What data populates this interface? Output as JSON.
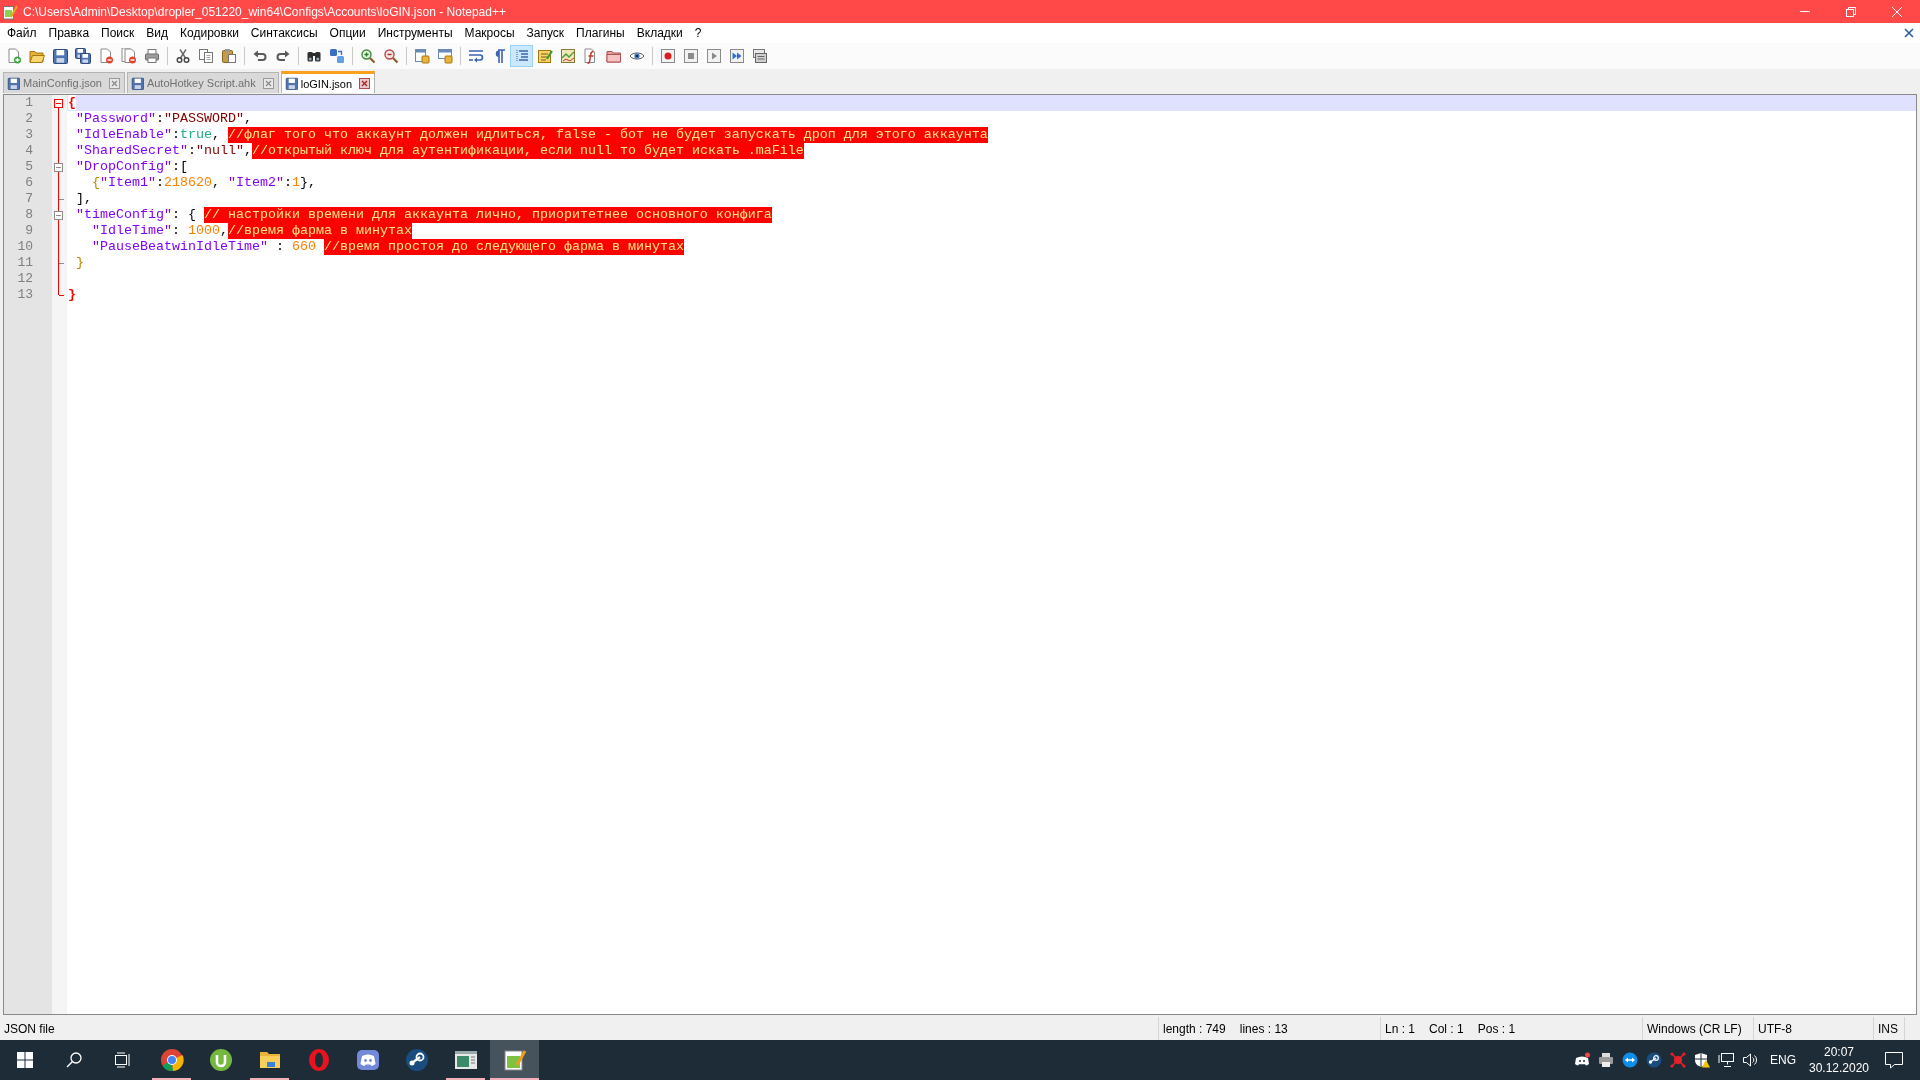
{
  "window": {
    "title": "C:\\Users\\Admin\\Desktop\\dropler_051220_win64\\Configs\\Accounts\\loGIN.json - Notepad++"
  },
  "menu": [
    "Файл",
    "Правка",
    "Поиск",
    "Вид",
    "Кодировки",
    "Синтаксисы",
    "Опции",
    "Инструменты",
    "Макросы",
    "Запуск",
    "Плагины",
    "Вкладки",
    "?"
  ],
  "toolbar": {
    "groups": [
      [
        {
          "on": false
        },
        {
          "on": false
        },
        {
          "on": false
        },
        {
          "on": false
        },
        {
          "on": false
        },
        {
          "on": false
        },
        {
          "on": false
        }
      ],
      [
        {
          "on": false
        },
        {
          "on": false
        },
        {
          "on": false
        }
      ],
      [
        {
          "on": false
        },
        {
          "on": false
        }
      ],
      [
        {
          "on": false
        },
        {
          "on": false
        }
      ],
      [
        {
          "on": false
        },
        {
          "on": false
        }
      ],
      [
        {
          "on": false
        },
        {
          "on": false
        }
      ],
      [
        {
          "on": false
        },
        {
          "on": false
        },
        {
          "on": true
        },
        {
          "on": false
        },
        {
          "on": false
        },
        {
          "on": false
        },
        {
          "on": false
        },
        {
          "on": false
        }
      ],
      [
        {
          "on": false
        },
        {
          "on": false
        },
        {
          "on": false
        },
        {
          "on": false
        },
        {
          "on": false
        }
      ]
    ]
  },
  "tabs": [
    {
      "label": "MainConfig.json",
      "selected": false
    },
    {
      "label": "AutoHotkey Script.ahk",
      "selected": false
    },
    {
      "label": "loGIN.json",
      "selected": true
    }
  ],
  "editor": {
    "lines": [
      {
        "number": "1",
        "current": true,
        "fold": {
          "kind": "start",
          "active": true
        },
        "tokens": [
          {
            "kind": "brace",
            "text": "{"
          }
        ]
      },
      {
        "number": "2",
        "current": false,
        "tokens": [
          {
            "kind": "key",
            "text": " \"Password\""
          },
          {
            "kind": "punct",
            "text": ":"
          },
          {
            "kind": "string",
            "text": "\"PASSWORD\""
          },
          {
            "kind": "punct",
            "text": ","
          }
        ]
      },
      {
        "number": "3",
        "current": false,
        "tokens": [
          {
            "kind": "key",
            "text": " \"IdleEnable\""
          },
          {
            "kind": "punct",
            "text": ":"
          },
          {
            "kind": "keyword",
            "text": "true"
          },
          {
            "kind": "punct",
            "text": ", "
          },
          {
            "kind": "comment",
            "text": "//флаг того что аккаунт должен идлиться, false - бот не будет запускать дроп для этого аккаунта"
          }
        ]
      },
      {
        "number": "4",
        "current": false,
        "tokens": [
          {
            "kind": "key",
            "text": " \"SharedSecret\""
          },
          {
            "kind": "punct",
            "text": ":"
          },
          {
            "kind": "string",
            "text": "\"null\""
          },
          {
            "kind": "punct",
            "text": ","
          },
          {
            "kind": "comment",
            "text": "//открытый ключ для аутентификации, если null то будет искать .maFile"
          }
        ]
      },
      {
        "number": "5",
        "current": false,
        "fold": {
          "kind": "start",
          "active": false
        },
        "tokens": [
          {
            "kind": "key",
            "text": " \"DropConfig\""
          },
          {
            "kind": "punct",
            "text": ":["
          }
        ]
      },
      {
        "number": "6",
        "current": false,
        "tokens": [
          {
            "kind": "bracket",
            "text": "   {"
          },
          {
            "kind": "key",
            "text": "\"Item1\""
          },
          {
            "kind": "punct",
            "text": ":"
          },
          {
            "kind": "number",
            "text": "218620"
          },
          {
            "kind": "punct",
            "text": ", "
          },
          {
            "kind": "key",
            "text": "\"Item2\""
          },
          {
            "kind": "punct",
            "text": ":"
          },
          {
            "kind": "number",
            "text": "1"
          },
          {
            "kind": "punct",
            "text": "},"
          }
        ]
      },
      {
        "number": "7",
        "current": false,
        "fold": {
          "kind": "end",
          "active": false
        },
        "tokens": [
          {
            "kind": "punct",
            "text": " ],"
          }
        ]
      },
      {
        "number": "8",
        "current": false,
        "fold": {
          "kind": "start",
          "active": false
        },
        "tokens": [
          {
            "kind": "key",
            "text": " \"timeConfig\""
          },
          {
            "kind": "punct",
            "text": ": { "
          },
          {
            "kind": "comment",
            "text": "// настройки времени для аккаунта лично, приоритетнее основного конфига"
          }
        ]
      },
      {
        "number": "9",
        "current": false,
        "tokens": [
          {
            "kind": "key",
            "text": "   \"IdleTime\""
          },
          {
            "kind": "punct",
            "text": ": "
          },
          {
            "kind": "number",
            "text": "1000"
          },
          {
            "kind": "punct",
            "text": ","
          },
          {
            "kind": "comment",
            "text": "//время фарма в минутах"
          }
        ]
      },
      {
        "number": "10",
        "current": false,
        "tokens": [
          {
            "kind": "key",
            "text": "   \"PauseBeatwinIdleTime\""
          },
          {
            "kind": "punct",
            "text": " : "
          },
          {
            "kind": "number",
            "text": "660 "
          },
          {
            "kind": "comment",
            "text": "//время простоя до следующего фарма в минутах"
          }
        ]
      },
      {
        "number": "11",
        "current": false,
        "fold": {
          "kind": "end",
          "active": false
        },
        "tokens": [
          {
            "kind": "bracket",
            "text": " }"
          }
        ]
      },
      {
        "number": "12",
        "current": false
      },
      {
        "number": "13",
        "current": false,
        "fold": {
          "kind": "end",
          "active": true
        },
        "tokens": [
          {
            "kind": "brace",
            "text": "}"
          }
        ]
      }
    ]
  },
  "status_bar": {
    "file_type": "JSON file",
    "length": "length : 749",
    "lines": "lines : 13",
    "ln": "Ln : 1",
    "col": "Col : 1",
    "pos": "Pos : 1",
    "eol": "Windows (CR LF)",
    "encoding": "UTF-8",
    "mode": "INS"
  },
  "taskbar": {
    "apps": [
      {
        "running": true,
        "selected": false
      },
      {
        "running": false,
        "selected": false
      },
      {
        "running": true,
        "selected": false
      },
      {
        "running": false,
        "selected": false
      },
      {
        "running": false,
        "selected": false
      },
      {
        "running": false,
        "selected": false
      },
      {
        "running": true,
        "selected": false
      },
      {
        "running": true,
        "selected": true
      }
    ],
    "tray": {
      "language": "ENG",
      "time": "20:07",
      "date": "30.12.2020"
    }
  }
}
